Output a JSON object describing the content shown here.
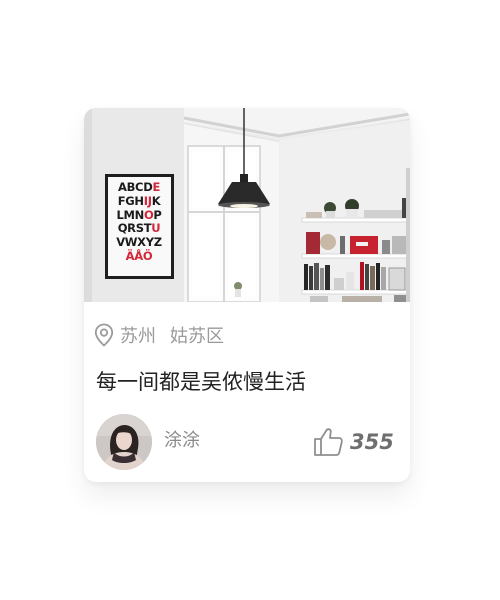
{
  "card": {
    "location": {
      "icon": "location-pin-icon",
      "city": "苏州",
      "district": "姑苏区"
    },
    "title": "每一间都是吴侬慢生活",
    "photo": {
      "poster_lines": [
        "ABCDE",
        "FGHIJK",
        "LMNOP",
        "QRSTU",
        "VWXYZ",
        "ÄÅÖ"
      ]
    },
    "author": {
      "name": "涂涂",
      "avatar": "avatar-photo"
    },
    "like": {
      "icon": "thumbs-up-icon",
      "count": "355"
    }
  }
}
